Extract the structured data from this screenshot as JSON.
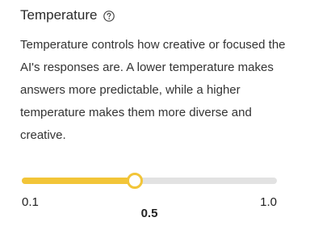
{
  "setting": {
    "title": "Temperature",
    "help_icon": "question-circle-icon",
    "description": "Temperature controls how creative or focused the AI's responses are. A lower temperature makes answers more predictable, while a higher temperature makes them more diverse and creative."
  },
  "slider": {
    "min_label": "0.1",
    "max_label": "1.0",
    "value_label": "0.5",
    "min": 0.1,
    "max": 1.0,
    "value": 0.5,
    "fill_color": "#f2c538",
    "track_color": "#e2e2e2"
  }
}
